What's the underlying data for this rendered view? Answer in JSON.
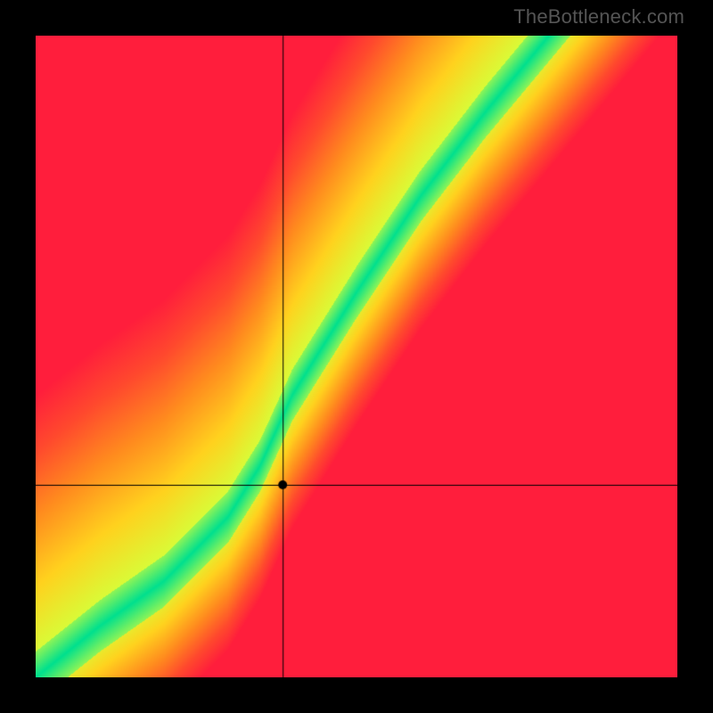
{
  "attribution": "TheBottleneck.com",
  "chart_data": {
    "type": "heatmap",
    "title": "",
    "xlabel": "",
    "ylabel": "",
    "xlim": [
      0,
      1
    ],
    "ylim": [
      0,
      1
    ],
    "crosshair": {
      "x": 0.385,
      "y": 0.3
    },
    "marker": {
      "x": 0.385,
      "y": 0.3
    },
    "optimal_band": {
      "description": "Green band where y is approximately f(x); diverges to red further away.",
      "control_points": [
        {
          "x": 0.0,
          "y": 0.0
        },
        {
          "x": 0.1,
          "y": 0.08
        },
        {
          "x": 0.2,
          "y": 0.15
        },
        {
          "x": 0.3,
          "y": 0.25
        },
        {
          "x": 0.35,
          "y": 0.33
        },
        {
          "x": 0.4,
          "y": 0.44
        },
        {
          "x": 0.5,
          "y": 0.6
        },
        {
          "x": 0.6,
          "y": 0.75
        },
        {
          "x": 0.7,
          "y": 0.88
        },
        {
          "x": 0.8,
          "y": 1.0
        }
      ],
      "band_half_width": 0.04
    },
    "gradient_stops": [
      {
        "t": 0.0,
        "color": "#00E08E"
      },
      {
        "t": 0.18,
        "color": "#D6FF3A"
      },
      {
        "t": 0.4,
        "color": "#FFD21E"
      },
      {
        "t": 0.62,
        "color": "#FF8C1E"
      },
      {
        "t": 0.82,
        "color": "#FF4A2D"
      },
      {
        "t": 1.0,
        "color": "#FF1E3C"
      }
    ],
    "note": "Axes are unlabeled in the source image; values are normalized 0–1 fractions of plot width/height."
  }
}
